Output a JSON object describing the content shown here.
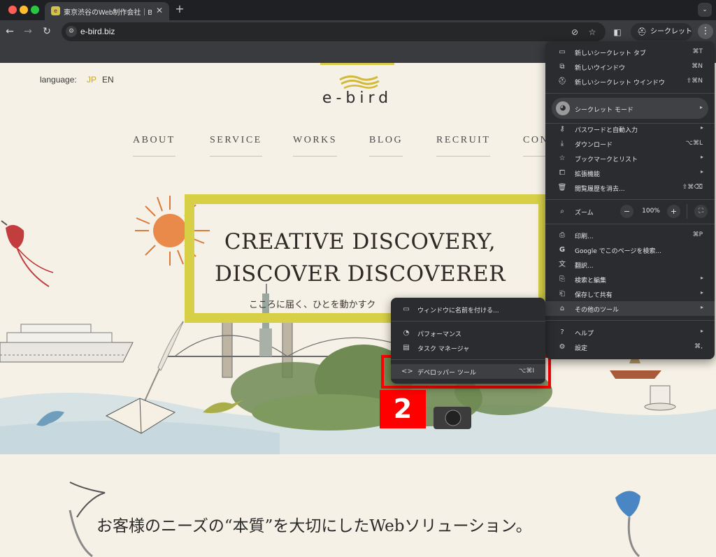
{
  "browser": {
    "tab_title": "東京渋谷のWeb制作会社｜BtoB",
    "url": "e-bird.biz",
    "incognito_label": "シークレット"
  },
  "page": {
    "language_label": "language:",
    "lang_jp": "JP",
    "lang_en": "EN",
    "logo_text": "e-bird",
    "nav": [
      "ABOUT",
      "SERVICE",
      "WORKS",
      "BLOG",
      "RECRUIT",
      "CON"
    ],
    "hero_line1": "CREATIVE DISCOVERY,",
    "hero_line2": "DISCOVER DISCOVERER",
    "hero_sub": "こころに届く、ひとを動かすク",
    "book_text": "e-bird",
    "bottom_heading": "お客様のニーズの“本質”を大切にしたWebソリューション。"
  },
  "menu": {
    "group1": [
      {
        "icon": "new-tab-icon",
        "label": "新しいシークレット タブ",
        "shortcut": "⌘T"
      },
      {
        "icon": "new-window-icon",
        "label": "新しいウインドウ",
        "shortcut": "⌘N"
      },
      {
        "icon": "incognito-icon",
        "label": "新しいシークレット ウインドウ",
        "shortcut": "⇧⌘N"
      }
    ],
    "incognito_mode": "シークレット モード",
    "group2": [
      {
        "icon": "key-icon",
        "label": "パスワードと自動入力",
        "shortcut": ""
      },
      {
        "icon": "download-icon",
        "label": "ダウンロード",
        "shortcut": "⌥⌘L"
      },
      {
        "icon": "star-icon",
        "label": "ブックマークとリスト",
        "shortcut": ""
      },
      {
        "icon": "extension-icon",
        "label": "拡張機能",
        "shortcut": ""
      },
      {
        "icon": "trash-icon",
        "label": "閲覧履歴を消去...",
        "shortcut": "⇧⌘⌫"
      }
    ],
    "zoom_label": "ズーム",
    "zoom_value": "100%",
    "group3": [
      {
        "icon": "print-icon",
        "label": "印刷...",
        "shortcut": "⌘P"
      },
      {
        "icon": "google-icon",
        "label": "Google でこのページを検索...",
        "shortcut": ""
      },
      {
        "icon": "translate-icon",
        "label": "翻訳...",
        "shortcut": ""
      },
      {
        "icon": "search-edit-icon",
        "label": "検索と編集",
        "shortcut": ""
      },
      {
        "icon": "save-share-icon",
        "label": "保存して共有",
        "shortcut": ""
      },
      {
        "icon": "toolbox-icon",
        "label": "その他のツール",
        "shortcut": ""
      }
    ],
    "group4": [
      {
        "icon": "help-icon",
        "label": "ヘルプ",
        "shortcut": ""
      },
      {
        "icon": "settings-icon",
        "label": "設定",
        "shortcut": "⌘,"
      }
    ]
  },
  "submenu": {
    "items": [
      {
        "icon": "window-name-icon",
        "label": "ウィンドウに名前を付ける...",
        "shortcut": ""
      },
      {
        "icon": "performance-icon",
        "label": "パフォーマンス",
        "shortcut": ""
      },
      {
        "icon": "task-manager-icon",
        "label": "タスク マネージャ",
        "shortcut": ""
      },
      {
        "icon": "devtools-icon",
        "label": "デベロッパー ツール",
        "shortcut": "⌥⌘I"
      }
    ]
  },
  "annotation": {
    "step_number": "2",
    "color": "#ff0000"
  },
  "colors": {
    "accent_yellow": "#d7d047",
    "lang_active": "#c9a51a",
    "menu_bg": "#2b2c2f"
  }
}
